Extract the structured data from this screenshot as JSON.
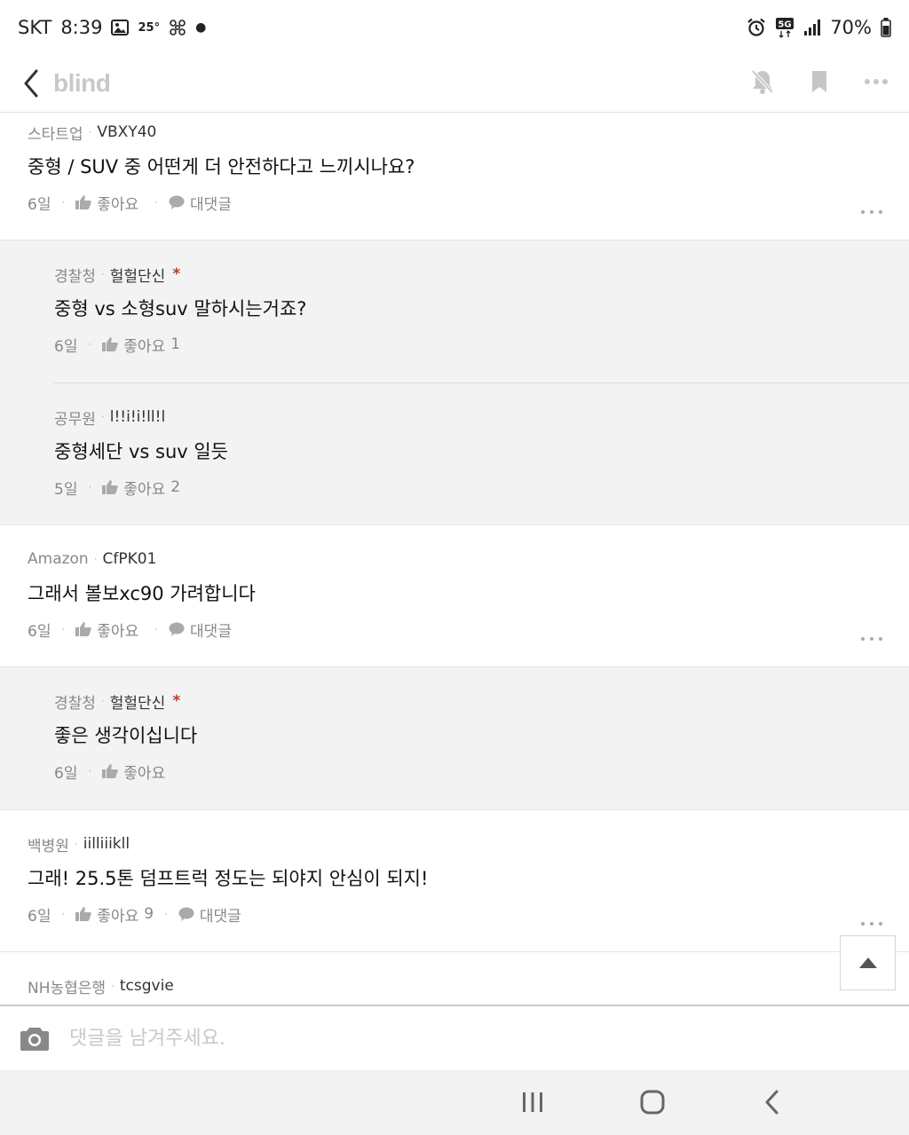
{
  "status_bar": {
    "carrier": "SKT",
    "time": "8:39",
    "temperature": "25°",
    "network": "5G",
    "battery": "70%",
    "icons": [
      "gallery-icon",
      "fan-icon",
      "alarm-icon",
      "5g-icon",
      "signal-icon",
      "battery-icon"
    ]
  },
  "header": {
    "logo": "blind",
    "icons": [
      "back-icon",
      "bell-off-icon",
      "bookmark-icon",
      "more-icon"
    ]
  },
  "comments": [
    {
      "company": "스타트업",
      "nickname": "VBXY40",
      "author_mark": "",
      "text": "중형 / SUV 중 어떤게 더 안전하다고 느끼시나요?",
      "time": "6일",
      "like_label": "좋아요",
      "like_count": "",
      "reply_label": "대댓글",
      "replies": [
        {
          "company": "경찰청",
          "nickname": "헐헐단신",
          "author_mark": "*",
          "text": "중형 vs 소형suv 말하시는거죠?",
          "time": "6일",
          "like_label": "좋아요",
          "like_count": "1"
        },
        {
          "company": "공무원",
          "nickname": "l!!i!i!ll!l",
          "author_mark": "",
          "text": "중형세단 vs suv 일듯",
          "time": "5일",
          "like_label": "좋아요",
          "like_count": "2"
        }
      ]
    },
    {
      "company": "Amazon",
      "nickname": "CfPK01",
      "author_mark": "",
      "text": "그래서 볼보xc90 가려합니다",
      "time": "6일",
      "like_label": "좋아요",
      "like_count": "",
      "reply_label": "대댓글",
      "replies": [
        {
          "company": "경찰청",
          "nickname": "헐헐단신",
          "author_mark": "*",
          "text": "좋은 생각이십니다",
          "time": "6일",
          "like_label": "좋아요",
          "like_count": ""
        }
      ]
    },
    {
      "company": "백병원",
      "nickname": "iilliiikll",
      "author_mark": "",
      "text": "그래! 25.5톤 덤프트럭 정도는 되야지 안심이 되지!",
      "time": "6일",
      "like_label": "좋아요",
      "like_count": "9",
      "reply_label": "대댓글",
      "replies": []
    },
    {
      "company": "NH농협은행",
      "nickname": "tcsgvie",
      "author_mark": "",
      "text": "",
      "time": "",
      "like_label": "",
      "like_count": "",
      "reply_label": "",
      "replies": []
    }
  ],
  "input": {
    "placeholder": "댓글을 남겨주세요.",
    "value": ""
  },
  "nav": {
    "icons": [
      "recent-apps-icon",
      "home-icon",
      "back-nav-icon"
    ]
  },
  "colors": {
    "reply_bg": "#f3f3f3",
    "author_mark": "#c0392b",
    "muted_text": "#888888",
    "logo": "#c8c8c8"
  }
}
